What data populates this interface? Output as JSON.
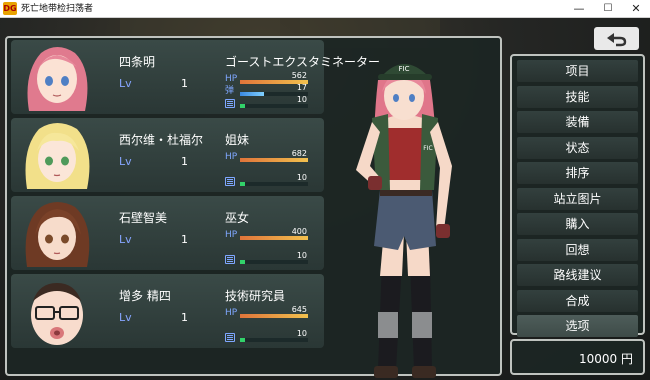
{
  "window": {
    "icon_text": "DG",
    "title": "死亡地带检扫荡者",
    "minimize": "—",
    "maximize": "☐",
    "close": "✕"
  },
  "labels": {
    "lv": "Lv",
    "hp": "HP",
    "sp": "弹"
  },
  "colors": {
    "hp_bar": "#f2c14e",
    "sp_bar": "#7fd0ff",
    "exp_bar": "#32d26a",
    "level_label": "#86a6ff"
  },
  "party": [
    {
      "name": "四条明",
      "level": "1",
      "class": "ゴーストエクスタミネーター",
      "hp": "562",
      "hp_ratio": 1.0,
      "sp": "17",
      "sp_ratio": 0.35,
      "exp": "10",
      "exp_ratio": 0.08,
      "has_sp": true
    },
    {
      "name": "西尔维・杜福尔",
      "level": "1",
      "class": "姐妹",
      "hp": "682",
      "hp_ratio": 1.0,
      "exp": "10",
      "exp_ratio": 0.08,
      "has_sp": false
    },
    {
      "name": "石壁智美",
      "level": "1",
      "class": "巫女",
      "hp": "400",
      "hp_ratio": 1.0,
      "exp": "10",
      "exp_ratio": 0.08,
      "has_sp": false
    },
    {
      "name": "增多 精四",
      "level": "1",
      "class": "技術研究員",
      "hp": "645",
      "hp_ratio": 1.0,
      "exp": "10",
      "exp_ratio": 0.08,
      "has_sp": false
    }
  ],
  "sprite": {
    "cap_text": "FIC",
    "vest_text": "FIC"
  },
  "menu": {
    "items": [
      "项目",
      "技能",
      "装備",
      "状态",
      "排序",
      "站立图片",
      "購入",
      "回想",
      "路线建议",
      "合成",
      "选项"
    ],
    "active_index": 10
  },
  "gold": "10000 円",
  "back_icon": "return-arrow-icon"
}
